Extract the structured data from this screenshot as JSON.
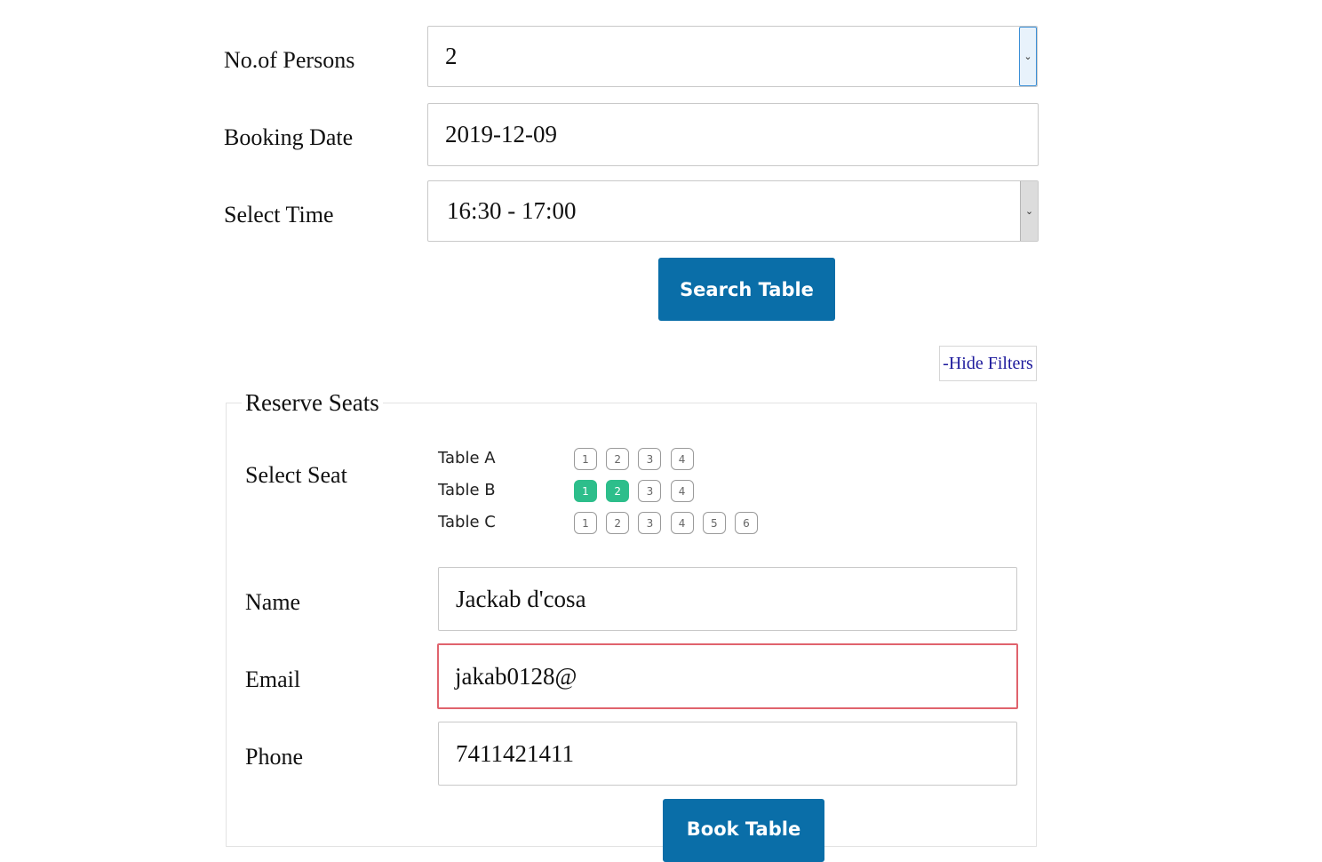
{
  "filters": {
    "persons": {
      "label": "No.of Persons",
      "value": "2",
      "arrow": "⌄"
    },
    "date": {
      "label": "Booking Date",
      "value": "2019-12-09"
    },
    "time": {
      "label": "Select Time",
      "value": "16:30 - 17:00",
      "arrow": "⌄"
    },
    "search_button": "Search Table",
    "hide_filters": "-Hide Filters"
  },
  "reserve": {
    "legend": "Reserve Seats",
    "select_seat_label": "Select Seat",
    "tables": [
      {
        "name": "Table A",
        "seats": [
          "1",
          "2",
          "3",
          "4"
        ],
        "selected": []
      },
      {
        "name": "Table B",
        "seats": [
          "1",
          "2",
          "3",
          "4"
        ],
        "selected": [
          "1",
          "2"
        ]
      },
      {
        "name": "Table C",
        "seats": [
          "1",
          "2",
          "3",
          "4",
          "5",
          "6"
        ],
        "selected": []
      }
    ],
    "name": {
      "label": "Name",
      "value": "Jackab d'cosa"
    },
    "email": {
      "label": "Email",
      "value": "jakab0128@"
    },
    "phone": {
      "label": "Phone",
      "value": "7411421411"
    },
    "book_button": "Book Table"
  },
  "colors": {
    "primary_button": "#0a6ea8",
    "seat_selected": "#2dbe8b",
    "error_border": "#e0636d",
    "link": "#1d1a9c"
  }
}
